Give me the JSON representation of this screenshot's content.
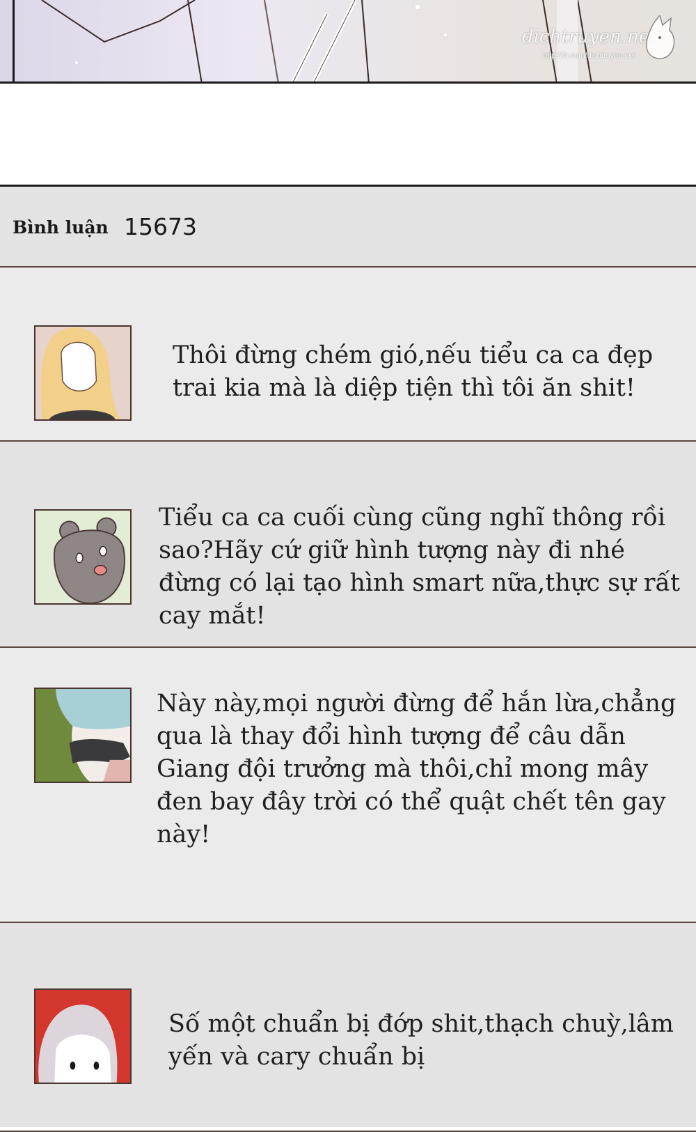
{
  "watermark": {
    "name": "dichtruyen.net",
    "url": "http://fb.com/dichtruyen.net"
  },
  "comments_header": {
    "label": "Bình luận",
    "count": "15673"
  },
  "comments": [
    {
      "avatar": "blonde-girl-avatar",
      "text": "Thôi đừng chém gió,nếu tiểu ca ca đẹp trai kia mà là diệp tiện thì tôi ăn shit!"
    },
    {
      "avatar": "gray-bear-avatar",
      "text": "Tiểu ca ca cuối cùng cũng nghĩ thông rồi sao?Hãy cứ giữ hình tượng này đi nhé đừng có lại tạo hình smart nữa,thực sự rất cay mắt!"
    },
    {
      "avatar": "blue-hair-scarf-avatar",
      "text": "Này này,mọi người đừng để hắn lừa,chẳng qua là thay đổi hình tượng để câu dẫn Giang đội trưởng mà thôi,chỉ mong mây đen bay đây trời có thể quật chết tên gay này!"
    },
    {
      "avatar": "white-hair-red-bg-avatar",
      "text": "Số một chuẩn bị đớp shit,thạch chuỳ,lâm yến và cary chuẩn bị"
    }
  ],
  "colors": {
    "section_bg": "#e4e3e4",
    "divider": "#5a4640",
    "text": "#1f1f1f"
  }
}
